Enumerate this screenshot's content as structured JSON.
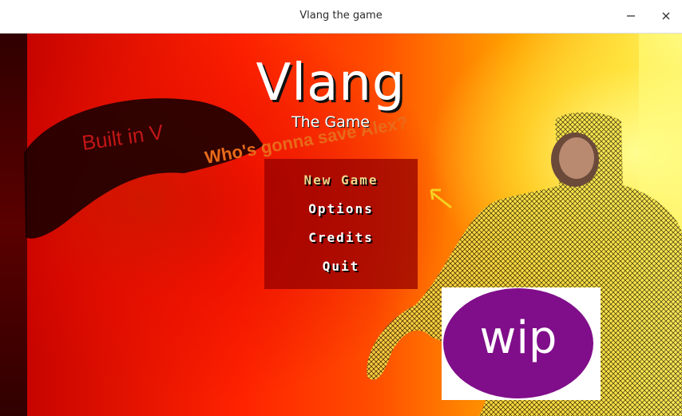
{
  "window": {
    "title": "Vlang the game",
    "minimize_icon": "minimize-icon",
    "close_icon": "close-icon"
  },
  "game": {
    "title": "Vlang",
    "subtitle": "The Game",
    "built_in_text": "Built in V",
    "tagline": "Who's gonna save Alex?"
  },
  "menu": {
    "items": [
      {
        "label": "New Game",
        "selected": true
      },
      {
        "label": "Options",
        "selected": false
      },
      {
        "label": "Credits",
        "selected": false
      },
      {
        "label": "Quit",
        "selected": false
      }
    ]
  },
  "badge": {
    "label": "wip",
    "color": "#800e8a"
  },
  "colors": {
    "menu_panel": "#960000",
    "selected_item": "#f2d38a",
    "menu_text": "#ffffff",
    "tagline": "#e86a1a"
  },
  "icons": {
    "arrow": "arrow-icon",
    "character": "wireframe-character-icon"
  }
}
